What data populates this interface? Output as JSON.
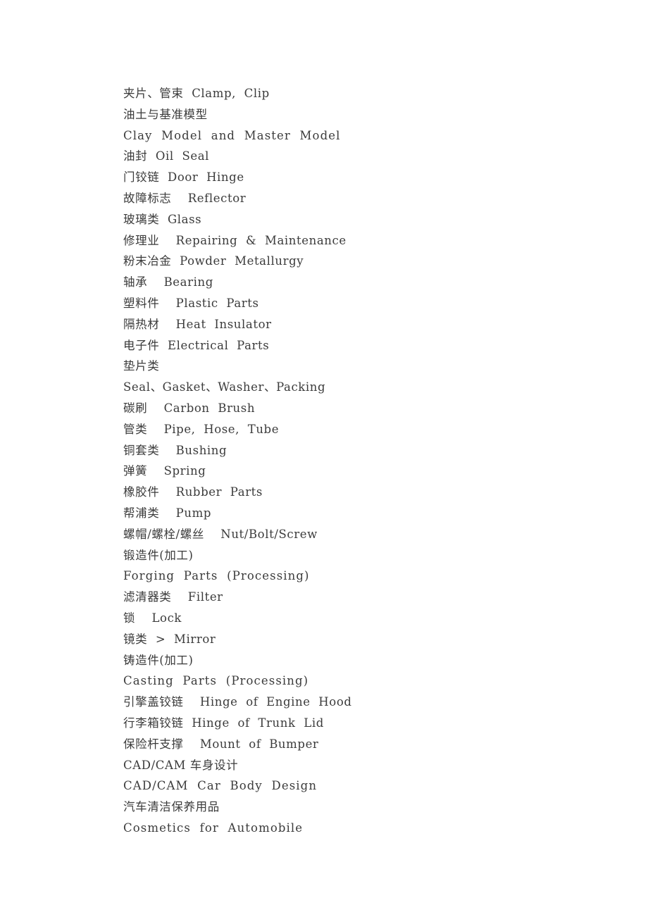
{
  "document": {
    "background_color": "#ffffff",
    "text_color": "#3b3b3b",
    "lines": [
      {
        "text": "夹片、管束  Clamp,  Clip",
        "script": "mixed"
      },
      {
        "text": "油土与基准模型",
        "script": "cjk"
      },
      {
        "text": "Clay  Model  and  Master  Model",
        "script": "latin"
      },
      {
        "text": "油封  Oil  Seal",
        "script": "mixed"
      },
      {
        "text": "门铰链  Door  Hinge",
        "script": "mixed"
      },
      {
        "text": "故障标志    Reflector",
        "script": "mixed"
      },
      {
        "text": "玻璃类  Glass",
        "script": "mixed"
      },
      {
        "text": "修理业    Repairing  &  Maintenance",
        "script": "mixed"
      },
      {
        "text": "粉末冶金  Powder  Metallurgy",
        "script": "mixed"
      },
      {
        "text": "轴承    Bearing",
        "script": "mixed"
      },
      {
        "text": "塑料件    Plastic  Parts",
        "script": "mixed"
      },
      {
        "text": "隔热材    Heat  Insulator",
        "script": "mixed"
      },
      {
        "text": "电子件  Electrical  Parts",
        "script": "mixed"
      },
      {
        "text": "垫片类",
        "script": "cjk"
      },
      {
        "text": "Seal、Gasket、Washer、Packing",
        "script": "mixed"
      },
      {
        "text": "碳刷    Carbon  Brush",
        "script": "mixed"
      },
      {
        "text": "管类    Pipe,  Hose,  Tube",
        "script": "mixed"
      },
      {
        "text": "铜套类    Bushing",
        "script": "mixed"
      },
      {
        "text": "弹簧    Spring",
        "script": "mixed"
      },
      {
        "text": "橡胶件    Rubber  Parts",
        "script": "mixed"
      },
      {
        "text": "帮浦类    Pump",
        "script": "mixed"
      },
      {
        "text": "螺帽/螺栓/螺丝    Nut/Bolt/Screw",
        "script": "mixed"
      },
      {
        "text": "锻造件(加工)",
        "script": "cjk"
      },
      {
        "text": "Forging  Parts  (Processing)",
        "script": "latin"
      },
      {
        "text": "滤清器类    Filter",
        "script": "mixed"
      },
      {
        "text": "锁    Lock",
        "script": "mixed"
      },
      {
        "text": "镜类  >  Mirror",
        "script": "mixed"
      },
      {
        "text": "铸造件(加工)",
        "script": "cjk"
      },
      {
        "text": "Casting  Parts  (Processing)",
        "script": "latin"
      },
      {
        "text": "引擎盖铰链    Hinge  of  Engine  Hood",
        "script": "mixed"
      },
      {
        "text": "行李箱铰链  Hinge  of  Trunk  Lid",
        "script": "mixed"
      },
      {
        "text": "保险杆支撑    Mount  of  Bumper",
        "script": "mixed"
      },
      {
        "text": "CAD/CAM 车身设计",
        "script": "mixed"
      },
      {
        "text": "CAD/CAM  Car  Body  Design",
        "script": "latin"
      },
      {
        "text": "汽车清洁保养用品",
        "script": "cjk"
      },
      {
        "text": "Cosmetics  for  Automobile",
        "script": "latin"
      }
    ]
  }
}
